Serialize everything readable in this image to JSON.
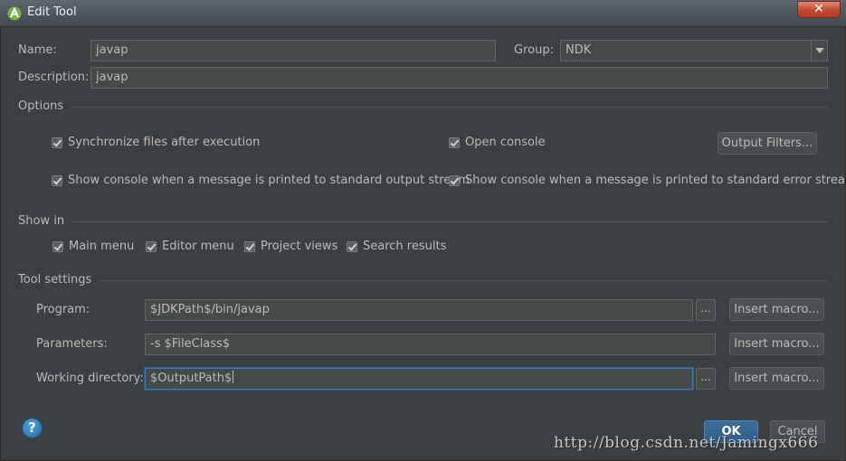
{
  "window": {
    "title": "Edit Tool",
    "close_glyph": "✕"
  },
  "name": {
    "label": "Name:",
    "value": "javap"
  },
  "group": {
    "label": "Group:",
    "value": "NDK"
  },
  "description": {
    "label": "Description:",
    "value": "javap"
  },
  "options": {
    "section_label": "Options",
    "sync_files": "Synchronize files after execution",
    "open_console": "Open console",
    "output_filters_button": "Output Filters...",
    "show_console_stdout": "Show console when a message is printed to standard output stream",
    "show_console_stderr": "Show console when a message is printed to standard error stream"
  },
  "show_in": {
    "section_label": "Show in",
    "items": [
      "Main menu",
      "Editor menu",
      "Project views",
      "Search results"
    ]
  },
  "tool_settings": {
    "section_label": "Tool settings",
    "program_label": "Program:",
    "program_value": "$JDKPath$/bin/javap",
    "parameters_label": "Parameters:",
    "parameters_value": "-s $FileClass$",
    "working_dir_label": "Working directory:",
    "working_dir_value": "$OutputPath$",
    "browse_label": "...",
    "insert_macro_label": "Insert macro..."
  },
  "footer": {
    "help_glyph": "?",
    "ok_label": "OK",
    "cancel_label": "Cancel"
  },
  "watermark": "http://blog.csdn.net/Jamingx666",
  "colors": {
    "background": "#3c3f41",
    "field": "#45494a",
    "accent": "#4a86c0"
  }
}
